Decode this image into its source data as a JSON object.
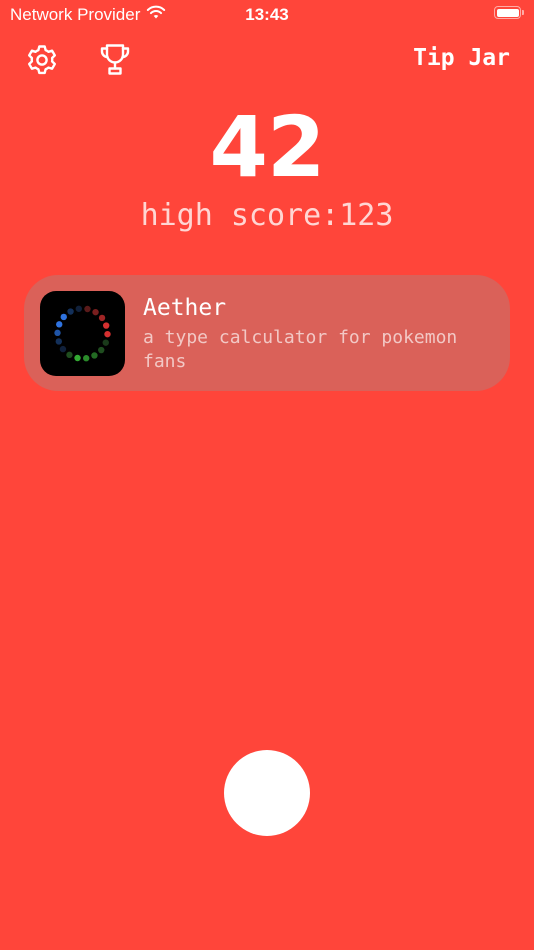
{
  "status_bar": {
    "carrier": "Network Provider",
    "time": "13:43",
    "wifi_icon": "wifi-icon",
    "battery_icon": "battery-icon",
    "battery_level": 1.0
  },
  "toolbar": {
    "settings_icon": "gear-icon",
    "achievements_icon": "trophy-icon",
    "tip_jar_label": "Tip Jar"
  },
  "game": {
    "score": "42",
    "high_score": "high score:123"
  },
  "promo": {
    "app_icon": "aether-app-icon",
    "title": "Aether",
    "subtitle": "a type calculator for pokemon fans"
  },
  "colors": {
    "background": "#FF453A",
    "text": "#FFFFFF",
    "card": "#CC5A55",
    "tap_button": "#FFFFFF"
  }
}
